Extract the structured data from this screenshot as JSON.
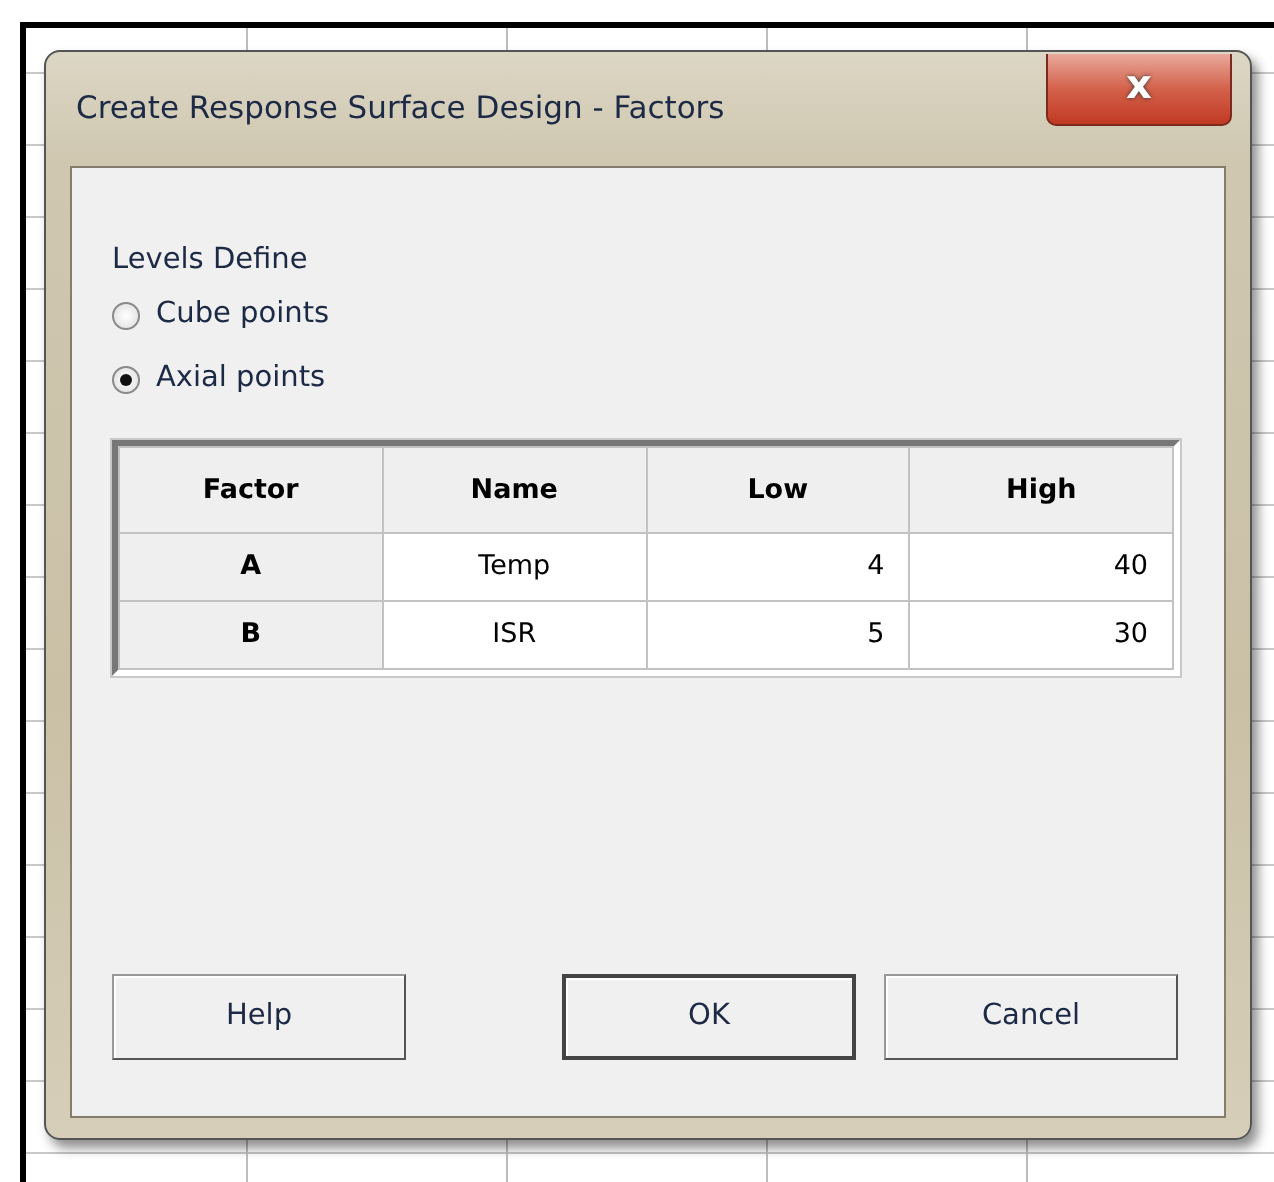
{
  "window": {
    "title": "Create Response Surface Design - Factors",
    "close_symbol": "x"
  },
  "levels": {
    "label": "Levels Define",
    "options": [
      {
        "label": "Cube points",
        "selected": false
      },
      {
        "label": "Axial points",
        "selected": true
      }
    ]
  },
  "table": {
    "columns": [
      "Factor",
      "Name",
      "Low",
      "High"
    ],
    "rows": [
      {
        "factor": "A",
        "name": "Temp",
        "low": "4",
        "high": "40"
      },
      {
        "factor": "B",
        "name": "ISR",
        "low": "5",
        "high": "30"
      }
    ]
  },
  "buttons": [
    {
      "label": "Help",
      "default": false
    },
    {
      "label": "OK",
      "default": true
    },
    {
      "label": "Cancel",
      "default": false
    }
  ]
}
